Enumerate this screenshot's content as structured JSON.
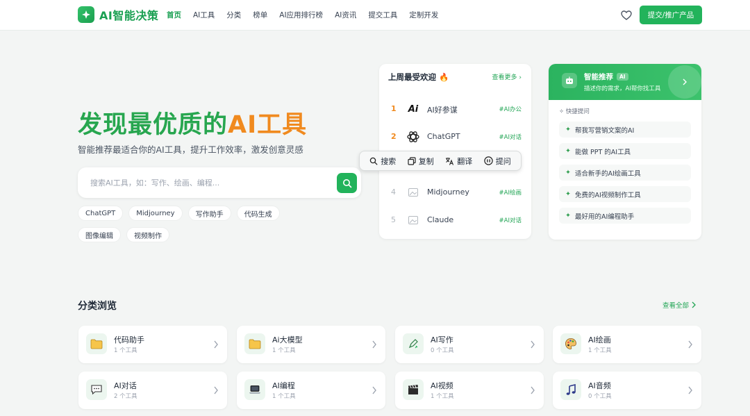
{
  "header": {
    "logo_text": "AI智能决策",
    "nav": [
      "首页",
      "AI工具",
      "分类",
      "榜单",
      "AI应用排行榜",
      "AI资讯",
      "提交工具",
      "定制开发"
    ],
    "active_nav": 0,
    "submit_label": "提交/推广产品"
  },
  "hero": {
    "title_part1": "发现最优质的",
    "title_part2": "AI工具",
    "subtitle": "智能推荐最适合你的AI工具，提升工作效率，激发创意灵感",
    "search_placeholder": "搜索AI工具，如：写作、绘画、编程...",
    "tags": [
      "ChatGPT",
      "Midjourney",
      "写作助手",
      "代码生成",
      "图像编辑",
      "视频制作"
    ]
  },
  "popular": {
    "title": "上周最受欢迎",
    "title_emoji": "🔥",
    "more": "查看更多",
    "items": [
      {
        "rank": "1",
        "name": "AI好参谋",
        "tag": "#AI办公",
        "icon": "ai-logo-icon"
      },
      {
        "rank": "2",
        "name": "ChatGPT",
        "tag": "#AI对话",
        "icon": "openai-icon"
      },
      {
        "rank": "4",
        "name": "Midjourney",
        "tag": "#AI绘画",
        "icon": "broken-image-icon"
      },
      {
        "rank": "5",
        "name": "Claude",
        "tag": "#AI对话",
        "icon": "broken-image-icon"
      }
    ]
  },
  "toolbar": {
    "items": [
      {
        "label": "搜索",
        "icon": "search-icon"
      },
      {
        "label": "复制",
        "icon": "copy-icon"
      },
      {
        "label": "翻译",
        "icon": "translate-icon"
      },
      {
        "label": "提问",
        "icon": "ask-icon"
      }
    ]
  },
  "recommend": {
    "title": "智能推荐",
    "badge": "AI",
    "desc": "描述你的需求，AI帮你找工具",
    "quick_label": "快捷提问",
    "items": [
      "帮我写营销文案的AI",
      "能做 PPT 的AI工具",
      "适合新手的AI绘画工具",
      "免费的AI视频制作工具",
      "最好用的AI编程助手"
    ]
  },
  "categories": {
    "title": "分类浏览",
    "view_all": "查看全部",
    "items": [
      {
        "name": "代码助手",
        "count": "1 个工具",
        "icon": "folder-icon"
      },
      {
        "name": "Ai大模型",
        "count": "1 个工具",
        "icon": "folder-icon"
      },
      {
        "name": "AI写作",
        "count": "0 个工具",
        "icon": "pen-icon"
      },
      {
        "name": "AI绘画",
        "count": "1 个工具",
        "icon": "palette-icon"
      },
      {
        "name": "AI对话",
        "count": "2 个工具",
        "icon": "chat-icon"
      },
      {
        "name": "AI编程",
        "count": "1 个工具",
        "icon": "laptop-icon"
      },
      {
        "name": "AI视频",
        "count": "1 个工具",
        "icon": "clapper-icon"
      },
      {
        "name": "AI音频",
        "count": "0 个工具",
        "icon": "music-icon"
      }
    ]
  },
  "colors": {
    "brand_green": "#22b35b",
    "accent_orange": "#f08a1f"
  }
}
